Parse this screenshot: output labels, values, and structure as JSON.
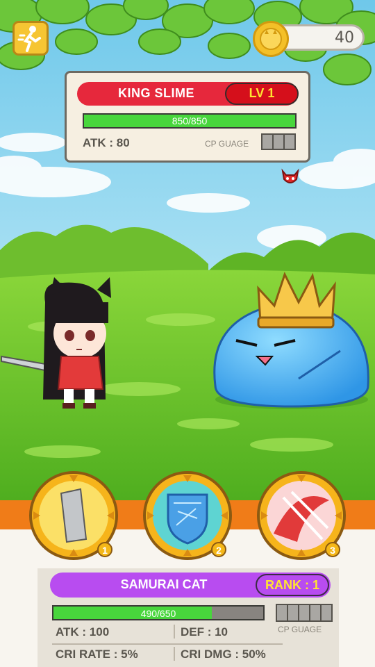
{
  "hud": {
    "exit_icon": "running-exit-icon",
    "coin_icon": "cat-coin-icon",
    "coins": "40"
  },
  "boss": {
    "name": "KING SLIME",
    "level": "LV 1",
    "hp_text": "850/850",
    "hp_fraction": 1.0,
    "atk": "ATK : 80",
    "cp_label": "CP GUAGE",
    "cp_cells": 3,
    "status_icon": "demon-face-icon"
  },
  "skills": [
    {
      "icon": "sword-blade-icon",
      "number": "1"
    },
    {
      "icon": "shield-icon",
      "number": "2"
    },
    {
      "icon": "red-claw-slash-icon",
      "number": "3"
    }
  ],
  "player": {
    "name": "SAMURAI CAT",
    "rank": "RANK : 1",
    "hp_text": "490/650",
    "hp_fraction": 0.754,
    "cp_label": "CP GUAGE",
    "cp_cells": 5,
    "atk": "ATK : 100",
    "def": "DEF : 10",
    "cri_rate": "CRI RATE : 5%",
    "cri_dmg": "CRI DMG : 50%"
  },
  "colors": {
    "boss_banner": "#e6283c",
    "player_banner": "#b84cf0",
    "hp_green": "#48d63c",
    "hud_orange": "#f07c18",
    "level_text": "#ffe433"
  }
}
